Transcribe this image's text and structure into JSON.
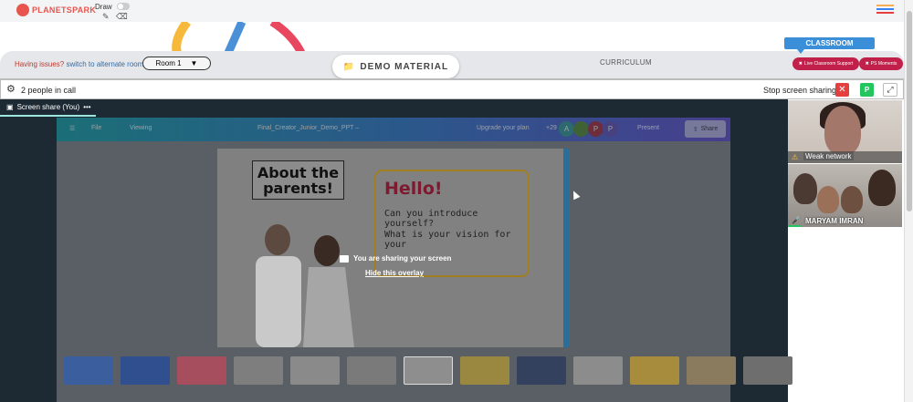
{
  "topbar": {
    "logo_text": "PLANETSPARK",
    "draw_label": "Draw",
    "icons": [
      "pencil-icon",
      "eraser-icon",
      "hamburger-menu-icon"
    ],
    "hamburger_colors": [
      "#f6ad55",
      "#3b82f6",
      "#e53e3e"
    ]
  },
  "nav": {
    "issue_text": "Having issues?",
    "issue_link": "switch to alternate room",
    "room_value": "Room 1",
    "demo_label": "DEMO MATERIAL",
    "curriculum_label": "CURRICULUM",
    "classroom_label": "CLASSROOM",
    "pill_support": "Live Classroom Support",
    "pill_moments": "PS Moments"
  },
  "callbar": {
    "people_text": "2 people in call",
    "stop_text": "Stop screen sharing",
    "participant_initial": "P"
  },
  "share": {
    "tab_label": "Screen share (You)",
    "tab_menu": "•••",
    "toolbar": {
      "file": "File",
      "viewing": "Viewing",
      "doc_title": "Final_Creator_Junior_Demo_PPT –",
      "upgrade": "Upgrade your plan",
      "count": "+29",
      "present": "Present",
      "share": "Share",
      "avatars": [
        "A",
        "P",
        "P"
      ]
    },
    "slide": {
      "about_title": "About the parents!",
      "hello": "Hello!",
      "q1": "Can you introduce yourself?",
      "q2": "What is your vision for your"
    },
    "overlay_msg": "You are sharing your screen",
    "hide_link": "Hide this overlay"
  },
  "videos": {
    "weak_network": "Weak network",
    "participant_name": "MARYAM IMRAN"
  },
  "colors": {
    "accent_blue": "#3b8ed8",
    "pill_red": "#c0204a",
    "stop_red": "#e53e3e",
    "green": "#22c55e"
  }
}
